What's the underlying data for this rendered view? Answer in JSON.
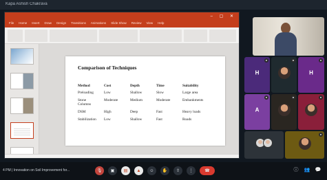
{
  "window": {
    "title": "Kapa Ashish Chakrava"
  },
  "ppt": {
    "ribbon_tabs": [
      "File",
      "Home",
      "Insert",
      "Draw",
      "Design",
      "Transitions",
      "Animations",
      "Slide Show",
      "Review",
      "View",
      "Help"
    ],
    "slide": {
      "title": "Comparison of Techniques",
      "table": {
        "headers": [
          "Method",
          "Cost",
          "Depth",
          "Time",
          "Suitability"
        ],
        "rows": [
          [
            "Preloading",
            "Low",
            "Shallow",
            "Slow",
            "Large area"
          ],
          [
            "Stone Columns",
            "Moderate",
            "Medium",
            "Moderate",
            "Embankments"
          ],
          [
            "DSM",
            "High",
            "Deep",
            "Fast",
            "Heavy loads"
          ],
          [
            "Stabilization",
            "Low",
            "Shallow",
            "Fast",
            "Roads"
          ]
        ]
      }
    }
  },
  "participants": [
    {
      "initial": "H",
      "color": "#4b2a7a"
    },
    {
      "initial": "",
      "color": "#1f2a2f"
    },
    {
      "initial": "H",
      "color": "#6a2a8a"
    },
    {
      "initial": "A",
      "color": "#7b3fa0"
    },
    {
      "initial": "",
      "color": "#2a2621"
    },
    {
      "initial": "",
      "color": "#8a1f3a"
    }
  ],
  "bottom": {
    "meeting_info": "4 PM  |  Innovation on Soil Improvement for..."
  }
}
